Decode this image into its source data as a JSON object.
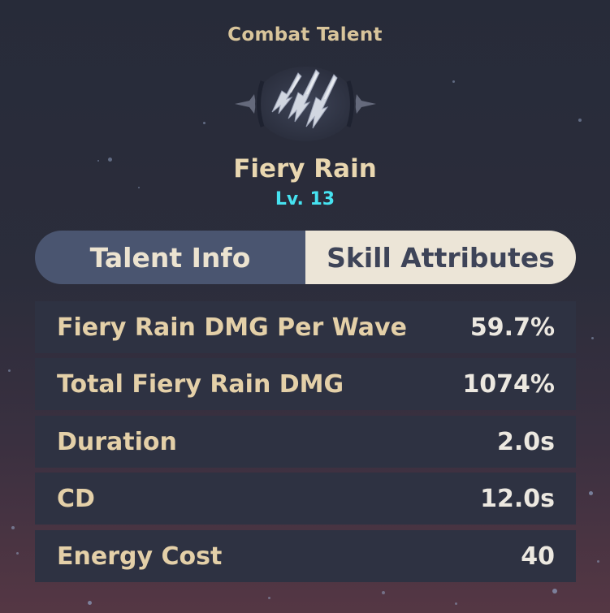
{
  "header": {
    "label": "Combat Talent"
  },
  "talent": {
    "name": "Fiery Rain",
    "level": "Lv. 13",
    "icon": "triple-arrow-icon"
  },
  "tabs": [
    {
      "label": "Talent Info",
      "active": false
    },
    {
      "label": "Skill Attributes",
      "active": true
    }
  ],
  "attributes": [
    {
      "name": "Fiery Rain DMG Per Wave",
      "value": "59.7%"
    },
    {
      "name": "Total Fiery Rain DMG",
      "value": "1074%"
    },
    {
      "name": "Duration",
      "value": "2.0s"
    },
    {
      "name": "CD",
      "value": "12.0s"
    },
    {
      "name": "Energy Cost",
      "value": "40"
    }
  ],
  "colors": {
    "accent_gold": "#e4d0a8",
    "level_cyan": "#46e2f0",
    "active_tab": "#ece5d7",
    "inactive_tab": "#4a5570",
    "row_bg": "#2e3242"
  }
}
